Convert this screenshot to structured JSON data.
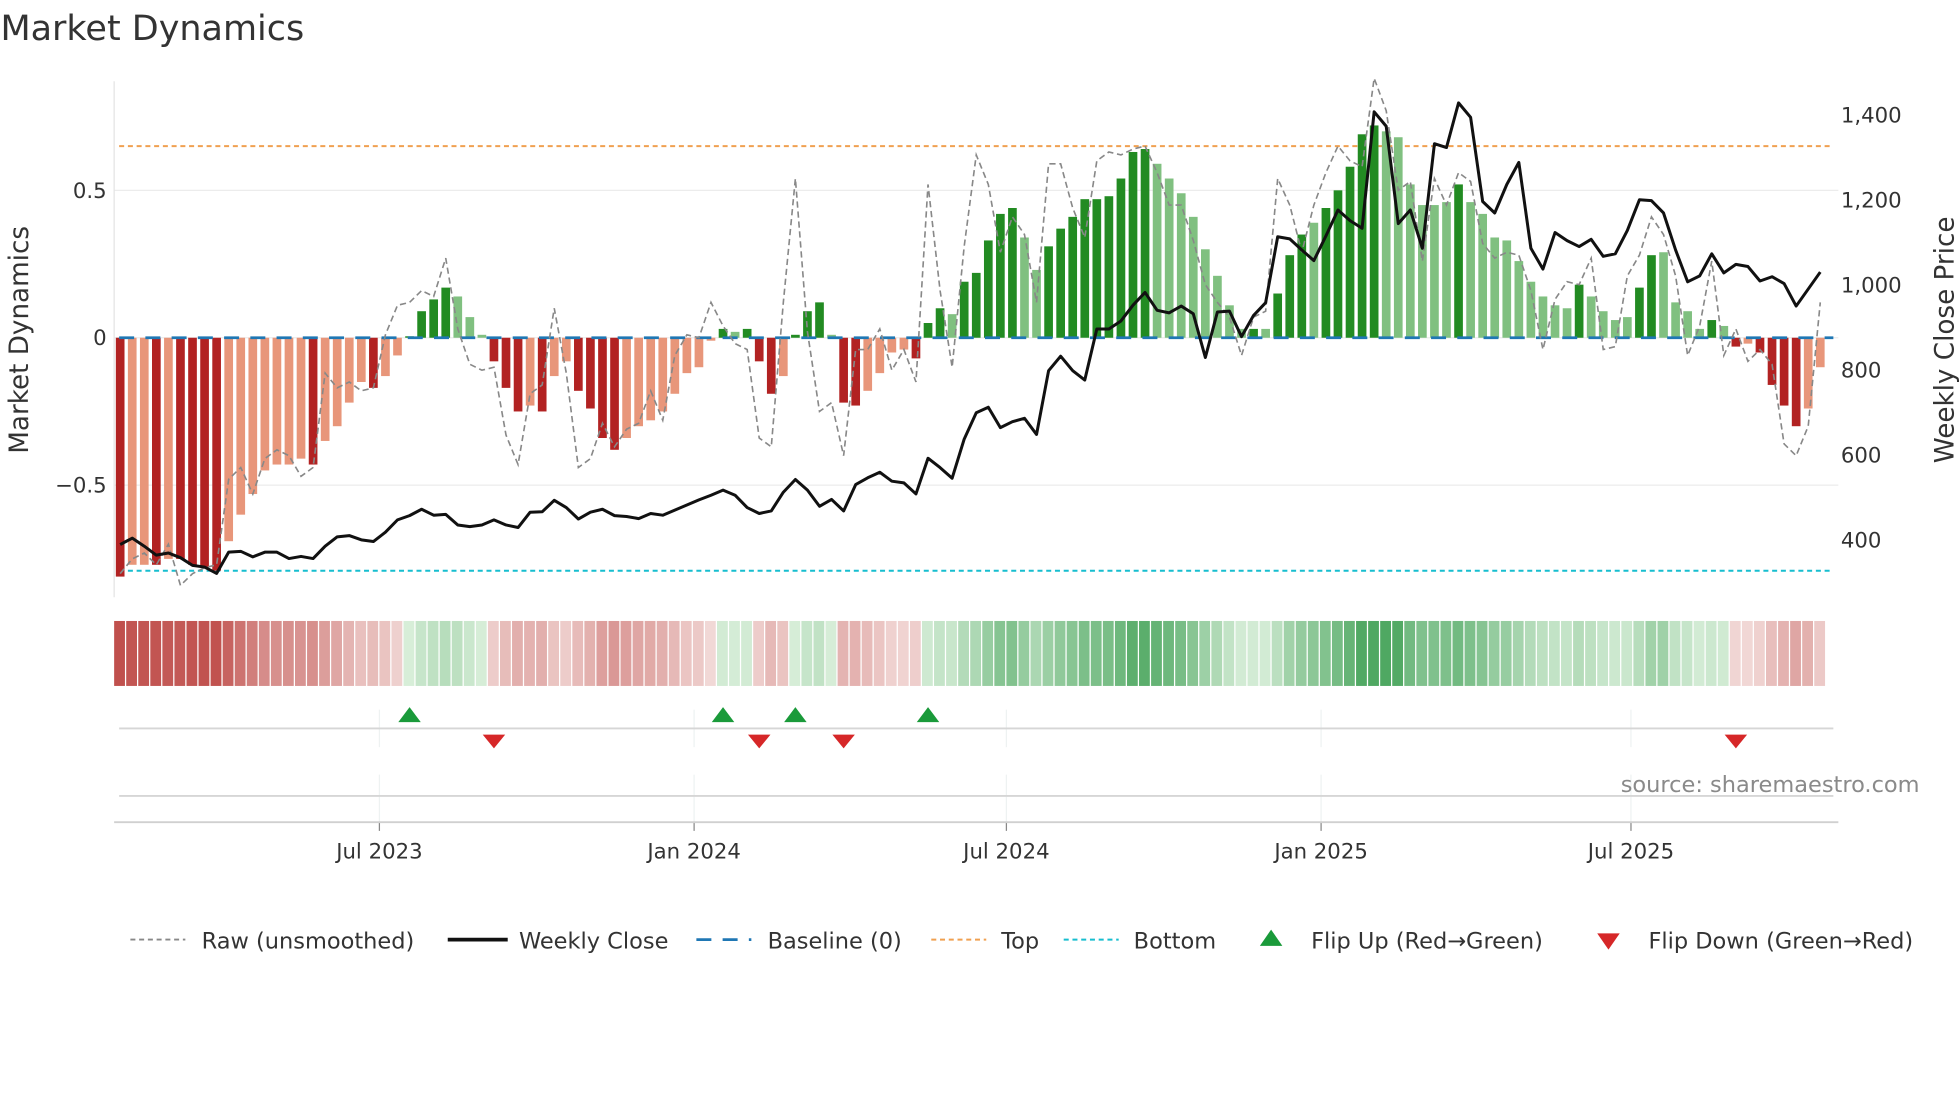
{
  "chart_data": {
    "type": "bar",
    "title": "Market Dynamics",
    "ylabel": "Market Dynamics",
    "ylabel_right": "Weekly Close Price",
    "ylim": [
      -0.88,
      0.87
    ],
    "ylim_right": [
      265,
      1479
    ],
    "xlim": [
      -0.5,
      142.5
    ],
    "x_unit": "week index (weekly bars, ~Feb 2023 to ~Oct 2025)",
    "x_ticks": [
      {
        "pos": 21.5,
        "label": "Jul 2023"
      },
      {
        "pos": 47.6,
        "label": "Jan 2024"
      },
      {
        "pos": 73.5,
        "label": "Jul 2024"
      },
      {
        "pos": 99.6,
        "label": "Jan 2025"
      },
      {
        "pos": 125.3,
        "label": "Jul 2025"
      }
    ],
    "y_ticks": [
      {
        "value": 0.5,
        "label": "0.5"
      },
      {
        "value": 0,
        "label": "0"
      },
      {
        "value": -0.5,
        "label": "−0.5"
      }
    ],
    "y_ticks_right": [
      {
        "value": 1400,
        "label": "1,400"
      },
      {
        "value": 1200,
        "label": "1,200"
      },
      {
        "value": 1000,
        "label": "1,000"
      },
      {
        "value": 800,
        "label": "800"
      },
      {
        "value": 600,
        "label": "600"
      },
      {
        "value": 400,
        "label": "400"
      }
    ],
    "top_level": 0.65,
    "bottom_level": -0.79,
    "baseline": 0,
    "smoothed": [
      -0.81,
      -0.77,
      -0.77,
      -0.77,
      -0.75,
      -0.75,
      -0.77,
      -0.78,
      -0.79,
      -0.69,
      -0.6,
      -0.53,
      -0.45,
      -0.43,
      -0.43,
      -0.41,
      -0.43,
      -0.35,
      -0.3,
      -0.22,
      -0.15,
      -0.17,
      -0.13,
      -0.06,
      0.005,
      0.09,
      0.13,
      0.17,
      0.14,
      0.07,
      0.01,
      -0.08,
      -0.17,
      -0.25,
      -0.23,
      -0.25,
      -0.13,
      -0.08,
      -0.18,
      -0.24,
      -0.34,
      -0.38,
      -0.34,
      -0.3,
      -0.28,
      -0.25,
      -0.19,
      -0.12,
      -0.1,
      -0.01,
      0.03,
      0.02,
      0.03,
      -0.08,
      -0.19,
      -0.13,
      0.01,
      0.09,
      0.12,
      0.01,
      -0.22,
      -0.23,
      -0.18,
      -0.12,
      -0.05,
      -0.04,
      -0.07,
      0.05,
      0.1,
      0.08,
      0.19,
      0.22,
      0.33,
      0.42,
      0.44,
      0.34,
      0.23,
      0.31,
      0.37,
      0.41,
      0.47,
      0.47,
      0.48,
      0.54,
      0.63,
      0.64,
      0.59,
      0.54,
      0.49,
      0.41,
      0.3,
      0.21,
      0.11,
      0.03,
      0.03,
      0.03,
      0.15,
      0.28,
      0.35,
      0.39,
      0.44,
      0.5,
      0.58,
      0.69,
      0.72,
      0.7,
      0.68,
      0.52,
      0.45,
      0.45,
      0.46,
      0.52,
      0.46,
      0.42,
      0.34,
      0.33,
      0.26,
      0.19,
      0.14,
      0.11,
      0.1,
      0.18,
      0.14,
      0.09,
      0.06,
      0.07,
      0.17,
      0.28,
      0.29,
      0.12,
      0.09,
      0.03,
      0.06,
      0.04,
      -0.03,
      -0.02,
      -0.05,
      -0.16,
      -0.23,
      -0.3,
      -0.24,
      -0.1
    ],
    "strengthening": [
      1,
      0,
      0,
      1,
      0,
      1,
      1,
      1,
      1,
      0,
      0,
      0,
      0,
      0,
      0,
      0,
      1,
      0,
      0,
      0,
      0,
      1,
      0,
      0,
      1,
      1,
      1,
      1,
      0,
      0,
      0,
      1,
      1,
      1,
      0,
      1,
      0,
      0,
      1,
      1,
      1,
      1,
      0,
      0,
      0,
      0,
      0,
      0,
      0,
      0,
      1,
      0,
      1,
      1,
      1,
      0,
      1,
      1,
      1,
      0,
      1,
      1,
      0,
      0,
      0,
      0,
      1,
      1,
      1,
      0,
      1,
      1,
      1,
      1,
      1,
      0,
      0,
      1,
      1,
      1,
      1,
      1,
      1,
      1,
      1,
      1,
      0,
      0,
      0,
      0,
      0,
      0,
      0,
      0,
      1,
      0,
      1,
      1,
      1,
      0,
      1,
      1,
      1,
      1,
      1,
      0,
      0,
      0,
      0,
      0,
      0,
      1,
      0,
      0,
      0,
      0,
      0,
      0,
      0,
      0,
      0,
      1,
      0,
      0,
      0,
      0,
      1,
      1,
      0,
      0,
      0,
      0,
      1,
      0,
      1,
      0,
      1,
      1,
      1,
      1,
      0,
      0
    ],
    "raw": [
      -0.8,
      -0.75,
      -0.73,
      -0.77,
      -0.7,
      -0.84,
      -0.8,
      -0.78,
      -0.77,
      -0.48,
      -0.44,
      -0.53,
      -0.41,
      -0.38,
      -0.4,
      -0.47,
      -0.44,
      -0.12,
      -0.17,
      -0.15,
      -0.18,
      -0.17,
      0.01,
      0.11,
      0.12,
      0.16,
      0.14,
      0.27,
      0.03,
      -0.09,
      -0.11,
      -0.1,
      -0.33,
      -0.43,
      -0.19,
      -0.16,
      0.1,
      -0.12,
      -0.44,
      -0.41,
      -0.29,
      -0.37,
      -0.31,
      -0.29,
      -0.18,
      -0.28,
      -0.06,
      0.01,
      0.0,
      0.12,
      0.04,
      -0.02,
      -0.04,
      -0.34,
      -0.37,
      0.12,
      0.54,
      0.02,
      -0.25,
      -0.22,
      -0.4,
      -0.04,
      -0.04,
      0.03,
      -0.11,
      -0.04,
      -0.15,
      0.52,
      0.16,
      -0.1,
      0.31,
      0.62,
      0.52,
      0.29,
      0.41,
      0.35,
      0.12,
      0.59,
      0.59,
      0.44,
      0.34,
      0.6,
      0.63,
      0.62,
      0.64,
      0.65,
      0.56,
      0.45,
      0.45,
      0.33,
      0.18,
      0.12,
      0.07,
      -0.06,
      0.07,
      0.09,
      0.54,
      0.45,
      0.29,
      0.45,
      0.56,
      0.65,
      0.6,
      0.58,
      0.88,
      0.77,
      0.5,
      0.53,
      0.26,
      0.54,
      0.45,
      0.56,
      0.53,
      0.32,
      0.27,
      0.29,
      0.28,
      0.16,
      -0.04,
      0.13,
      0.19,
      0.18,
      0.27,
      -0.04,
      -0.03,
      0.21,
      0.28,
      0.41,
      0.35,
      0.21,
      -0.06,
      0.04,
      0.26,
      -0.06,
      0.03,
      -0.08,
      -0.04,
      -0.09,
      -0.36,
      -0.4,
      -0.3,
      0.12
    ],
    "close": [
      389,
      404,
      385,
      364,
      369,
      358,
      340,
      336,
      321,
      371,
      373,
      360,
      371,
      371,
      356,
      361,
      356,
      385,
      407,
      410,
      400,
      396,
      418,
      447,
      457,
      472,
      458,
      460,
      435,
      431,
      435,
      447,
      435,
      429,
      465,
      466,
      493,
      476,
      449,
      465,
      472,
      457,
      455,
      450,
      462,
      458,
      470,
      482,
      494,
      505,
      517,
      505,
      476,
      462,
      468,
      512,
      542,
      517,
      479,
      495,
      468,
      530,
      546,
      559,
      538,
      534,
      508,
      592,
      570,
      545,
      637,
      699,
      712,
      664,
      678,
      686,
      648,
      798,
      832,
      798,
      776,
      896,
      896,
      915,
      952,
      982,
      940,
      934,
      950,
      932,
      829,
      936,
      938,
      878,
      928,
      958,
      1113,
      1108,
      1082,
      1057,
      1115,
      1176,
      1151,
      1133,
      1407,
      1373,
      1144,
      1176,
      1086,
      1332,
      1323,
      1428,
      1394,
      1196,
      1169,
      1236,
      1288,
      1086,
      1037,
      1123,
      1104,
      1090,
      1107,
      1067,
      1073,
      1128,
      1200,
      1198,
      1169,
      1082,
      1007,
      1021,
      1073,
      1028,
      1048,
      1043,
      1009,
      1019,
      1003,
      950,
      990,
      1030
    ],
    "flip_up": [
      24,
      50,
      56,
      67
    ],
    "flip_down": [
      31,
      53,
      60,
      134
    ],
    "legend": [
      {
        "key": "raw",
        "label": "Raw (unsmoothed)"
      },
      {
        "key": "close",
        "label": "Weekly Close"
      },
      {
        "key": "baseline",
        "label": "Baseline (0)"
      },
      {
        "key": "top",
        "label": "Top"
      },
      {
        "key": "bottom",
        "label": "Bottom"
      },
      {
        "key": "flip_up",
        "label": "Flip Up (Red→Green)"
      },
      {
        "key": "flip_down",
        "label": "Flip Down (Green→Red)"
      }
    ],
    "legend_placement": "bottom",
    "grid": true
  },
  "colors": {
    "dark_red": "#b22222",
    "light_red": "#e8967a",
    "dark_green": "#228b22",
    "light_green": "#80c080",
    "baseline": "#1f77b4",
    "top": "#f0a050",
    "bottom": "#17becf",
    "raw": "#888888",
    "close": "#111111",
    "flip_up": "#1a9a3a",
    "flip_down": "#d62728"
  },
  "source": "source: sharemaestro.com"
}
